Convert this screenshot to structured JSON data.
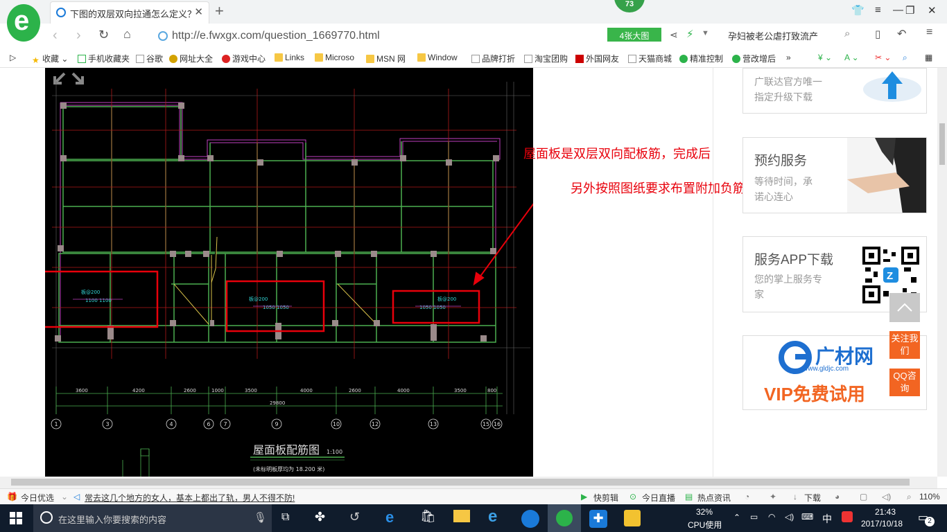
{
  "browser": {
    "tab_title": "下图的双层双向拉通怎么定义？这",
    "badge": "73",
    "url": "http://e.fwxgx.com/question_1669770.html",
    "bigimg_label": "4张大图",
    "search_suggestion": "孕妇被老公虐打致流产"
  },
  "bookmarks": [
    "收藏",
    "手机收藏夹",
    "谷歌",
    "网址大全",
    "游戏中心",
    "Links",
    "Microso",
    "MSN 网",
    "Window",
    "品牌打折",
    "淘宝团购",
    "外国网友",
    "天猫商城",
    "精准控制",
    "营改增后"
  ],
  "annotations": {
    "line1": "屋面板是双层双向配板筋，完成后",
    "line2": "另外按照图纸要求布置附加负筋"
  },
  "cad": {
    "dims": [
      "3600",
      "4200",
      "2600",
      "1000",
      "3500",
      "4000",
      "2600",
      "4000",
      "3500",
      "800"
    ],
    "total": "29800",
    "axes": [
      "1",
      "3",
      "4",
      "6",
      "7",
      "9",
      "10",
      "12",
      "13",
      "15",
      "16"
    ],
    "drawing_title": "屋面板配筋图",
    "scale": "1:100",
    "subtitle": "(未标明板厚均为 18.200 米)",
    "label_a": "板@200",
    "label_b": "1100  1100",
    "label_c": "1050  1050"
  },
  "sidebar": {
    "card1_s": "广联达官方唯一\n指定升级下载",
    "card2_h": "预约服务",
    "card2_s": "等待时间，承\n诺心连心",
    "card3_h": "服务APP下载",
    "card3_s": "您的掌上服务专\n家",
    "card4_brand": "广材网",
    "card4_url": "www.gldjc.com",
    "card4_vip": "VIP免费试用",
    "follow": "关注我们",
    "qq": "QQ咨询"
  },
  "statusbar": {
    "left": "今日优选",
    "news": "常去这几个地方的女人，基本上都出了轨，男人不得不防!",
    "items": [
      "快剪辑",
      "今日直播",
      "热点资讯",
      "下载",
      "110%"
    ]
  },
  "taskbar": {
    "search_placeholder": "在这里输入你要搜索的内容",
    "cpu_pct": "32%",
    "cpu_label": "CPU使用",
    "ime": "中",
    "time": "21:43",
    "date": "2017/10/18",
    "notif": "2"
  }
}
